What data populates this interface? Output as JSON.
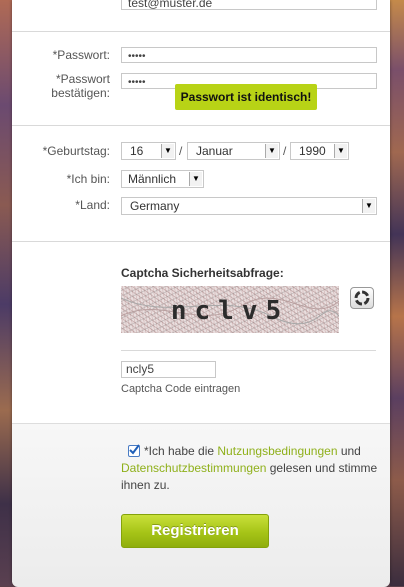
{
  "email": {
    "value": "test@muster.de"
  },
  "password": {
    "label": "*Passwort:",
    "value": "•••••"
  },
  "password_confirm": {
    "label_line1": "*Passwort",
    "label_line2": "bestätigen:",
    "value": "•••••"
  },
  "password_match_tooltip": "Passwort ist identisch!",
  "birthday": {
    "label": "*Geburtstag:",
    "day": "16",
    "month": "Januar",
    "year": "1990",
    "separator": "/"
  },
  "gender": {
    "label": "*Ich bin:",
    "value": "Männlich"
  },
  "country": {
    "label": "*Land:",
    "value": "Germany"
  },
  "captcha": {
    "heading": "Captcha Sicherheitsabfrage:",
    "image_text": "nclv5",
    "input_value": "ncly5",
    "hint": "Captcha Code eintragen"
  },
  "terms": {
    "checked": true,
    "prefix": "*Ich habe die ",
    "terms_link": "Nutzungsbedingungen",
    "middle": " und",
    "privacy_link": "Datenschutzbestimmungen",
    "suffix": " gelesen und stimme ihnen zu."
  },
  "submit_label": "Registrieren",
  "colors": {
    "accent_green": "#a6c417",
    "link_green": "#8fb01b",
    "tooltip_green": "#b8d316"
  }
}
